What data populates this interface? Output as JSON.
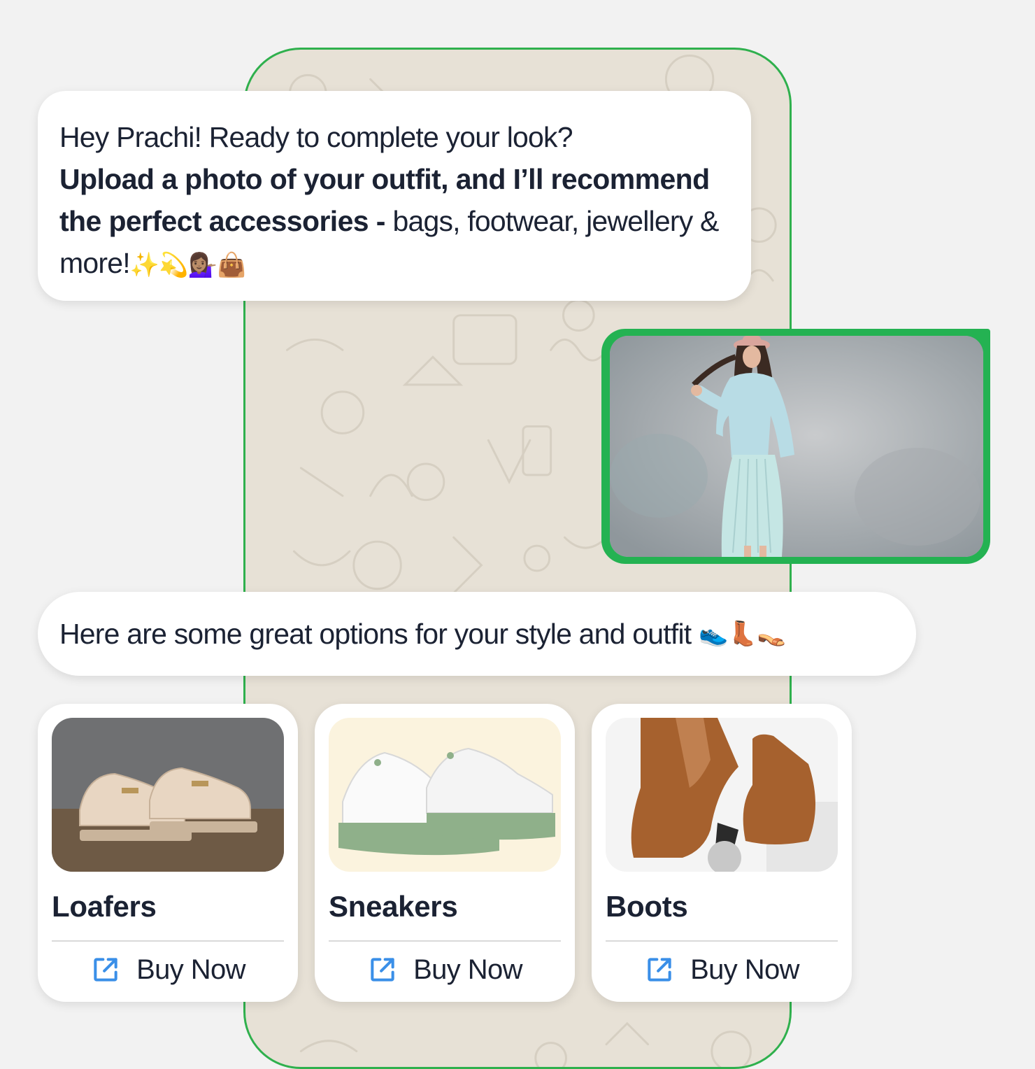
{
  "chat": {
    "greeting": {
      "line1": "Hey Prachi! Ready to complete your look?",
      "bold": "Upload a photo of your outfit, and I’ll recommend the perfect accessories -",
      "rest": " bags, footwear, jewellery & more!",
      "emojis": "✨💫💁🏽‍♀️👜"
    },
    "reply": {
      "text": "Here are some great options for your style and outfit",
      "emojis": "👟👢👡"
    }
  },
  "products": [
    {
      "title": "Loafers",
      "buy_label": "Buy Now"
    },
    {
      "title": "Sneakers",
      "buy_label": "Buy Now"
    },
    {
      "title": "Boots",
      "buy_label": "Buy Now"
    }
  ],
  "colors": {
    "accent_green": "#24b252",
    "link_blue": "#3a8fe8",
    "text": "#1b2233"
  },
  "icons": {
    "buy": "external-link-icon"
  }
}
